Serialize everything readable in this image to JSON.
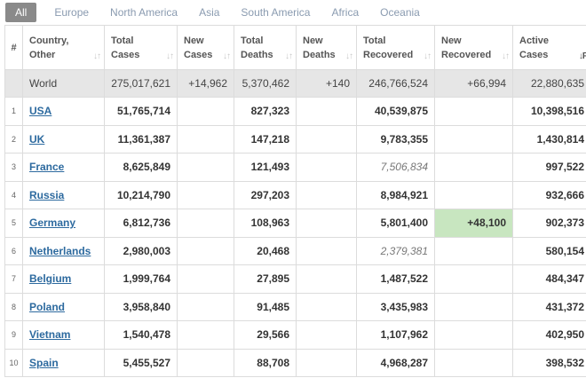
{
  "tabs": [
    "All",
    "Europe",
    "North America",
    "Asia",
    "South America",
    "Africa",
    "Oceania"
  ],
  "columns": {
    "num": "#",
    "country": [
      "Country,",
      "Other"
    ],
    "total_cases": [
      "Total",
      "Cases"
    ],
    "new_cases": [
      "New",
      "Cases"
    ],
    "total_deaths": [
      "Total",
      "Deaths"
    ],
    "new_deaths": [
      "New",
      "Deaths"
    ],
    "total_recovered": [
      "Total",
      "Recovered"
    ],
    "new_recovered": [
      "New",
      "Recovered"
    ],
    "active_cases": [
      "Active",
      "Cases"
    ]
  },
  "world": {
    "country": "World",
    "total_cases": "275,017,621",
    "new_cases": "+14,962",
    "total_deaths": "5,370,462",
    "new_deaths": "+140",
    "total_recovered": "246,766,524",
    "new_recovered": "+66,994",
    "active_cases": "22,880,635"
  },
  "rows": [
    {
      "idx": "1",
      "country": "USA",
      "total_cases": "51,765,714",
      "new_cases": "",
      "total_deaths": "827,323",
      "new_deaths": "",
      "total_recovered": "40,539,875",
      "new_recovered": "",
      "active_cases": "10,398,516"
    },
    {
      "idx": "2",
      "country": "UK",
      "total_cases": "11,361,387",
      "new_cases": "",
      "total_deaths": "147,218",
      "new_deaths": "",
      "total_recovered": "9,783,355",
      "new_recovered": "",
      "active_cases": "1,430,814"
    },
    {
      "idx": "3",
      "country": "France",
      "total_cases": "8,625,849",
      "new_cases": "",
      "total_deaths": "121,493",
      "new_deaths": "",
      "total_recovered": "7,506,834",
      "new_recovered": "",
      "active_cases": "997,522"
    },
    {
      "idx": "4",
      "country": "Russia",
      "total_cases": "10,214,790",
      "new_cases": "",
      "total_deaths": "297,203",
      "new_deaths": "",
      "total_recovered": "8,984,921",
      "new_recovered": "",
      "active_cases": "932,666"
    },
    {
      "idx": "5",
      "country": "Germany",
      "total_cases": "6,812,736",
      "new_cases": "",
      "total_deaths": "108,963",
      "new_deaths": "",
      "total_recovered": "5,801,400",
      "new_recovered": "+48,100",
      "active_cases": "902,373"
    },
    {
      "idx": "6",
      "country": "Netherlands",
      "total_cases": "2,980,003",
      "new_cases": "",
      "total_deaths": "20,468",
      "new_deaths": "",
      "total_recovered": "2,379,381",
      "new_recovered": "",
      "active_cases": "580,154"
    },
    {
      "idx": "7",
      "country": "Belgium",
      "total_cases": "1,999,764",
      "new_cases": "",
      "total_deaths": "27,895",
      "new_deaths": "",
      "total_recovered": "1,487,522",
      "new_recovered": "",
      "active_cases": "484,347"
    },
    {
      "idx": "8",
      "country": "Poland",
      "total_cases": "3,958,840",
      "new_cases": "",
      "total_deaths": "91,485",
      "new_deaths": "",
      "total_recovered": "3,435,983",
      "new_recovered": "",
      "active_cases": "431,372"
    },
    {
      "idx": "9",
      "country": "Vietnam",
      "total_cases": "1,540,478",
      "new_cases": "",
      "total_deaths": "29,566",
      "new_deaths": "",
      "total_recovered": "1,107,962",
      "new_recovered": "",
      "active_cases": "402,950"
    },
    {
      "idx": "10",
      "country": "Spain",
      "total_cases": "5,455,527",
      "new_cases": "",
      "total_deaths": "88,708",
      "new_deaths": "",
      "total_recovered": "4,968,287",
      "new_recovered": "",
      "active_cases": "398,532"
    }
  ],
  "icons": {
    "sort": "sort-arrows-icon",
    "sort_active": "sort-desc-icon"
  },
  "colors": {
    "tab_active_bg": "#8a8a8a",
    "link": "#2d6a9f",
    "world_row_bg": "#e6e6e6",
    "new_recovered_highlight": "#c8e6c0"
  }
}
